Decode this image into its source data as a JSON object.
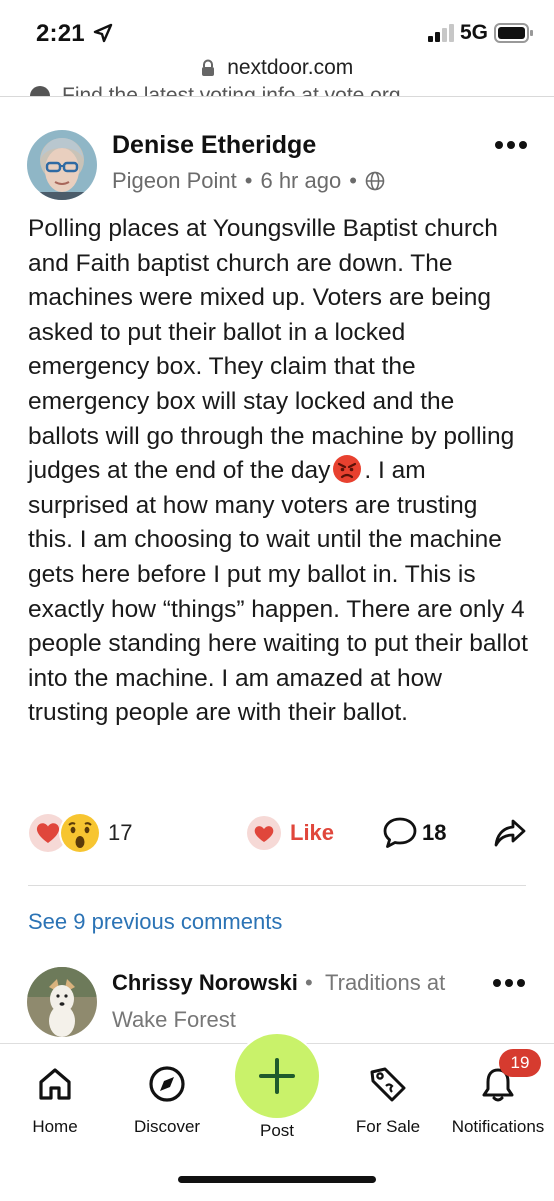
{
  "status_bar": {
    "time": "2:21",
    "network": "5G"
  },
  "browser": {
    "url": "nextdoor.com",
    "clipped_banner": "Find the latest voting info at vote.org"
  },
  "post": {
    "author": "Denise Etheridge",
    "neighborhood": "Pigeon Point",
    "separator": "•",
    "time_ago": "6 hr ago",
    "body_part1": "Polling places at Youngsville Baptist church and Faith baptist church are down. The machines were mixed up. Voters are being asked to put their ballot in a locked emergency box. They claim that the emergency box will stay locked and the ballots will go through the machine by polling judges at the end of the day",
    "body_emoji": "angry-face-emoji",
    "body_part2": ". I am surprised at how many voters are trusting this. I am choosing to wait until the machine gets here before I put my ballot in. This is exactly how “things” happen. There are only 4 people standing here waiting to put their ballot into the machine. I am amazed at how trusting people are with their ballot."
  },
  "reactions": {
    "count": "17",
    "like_label": "Like",
    "comment_count": "18",
    "icons": [
      "heart-icon",
      "surprised-face-icon"
    ]
  },
  "comments": {
    "see_previous": "See 9 previous comments",
    "preview": {
      "author": "Chrissy Norowski",
      "separator": "•",
      "neighborhood_line1": "Traditions at",
      "neighborhood_line2": "Wake Forest"
    }
  },
  "bottom_nav": {
    "items": [
      {
        "label": "Home",
        "icon": "home-icon"
      },
      {
        "label": "Discover",
        "icon": "compass-icon"
      },
      {
        "label": "Post",
        "icon": "plus-icon"
      },
      {
        "label": "For Sale",
        "icon": "tag-icon"
      },
      {
        "label": "Notifications",
        "icon": "bell-icon"
      }
    ],
    "notifications_badge": "19"
  },
  "colors": {
    "like_red": "#e0463b",
    "link_blue": "#2b73b5",
    "post_green": "#c9f26a",
    "badge_red": "#d63b2f"
  }
}
